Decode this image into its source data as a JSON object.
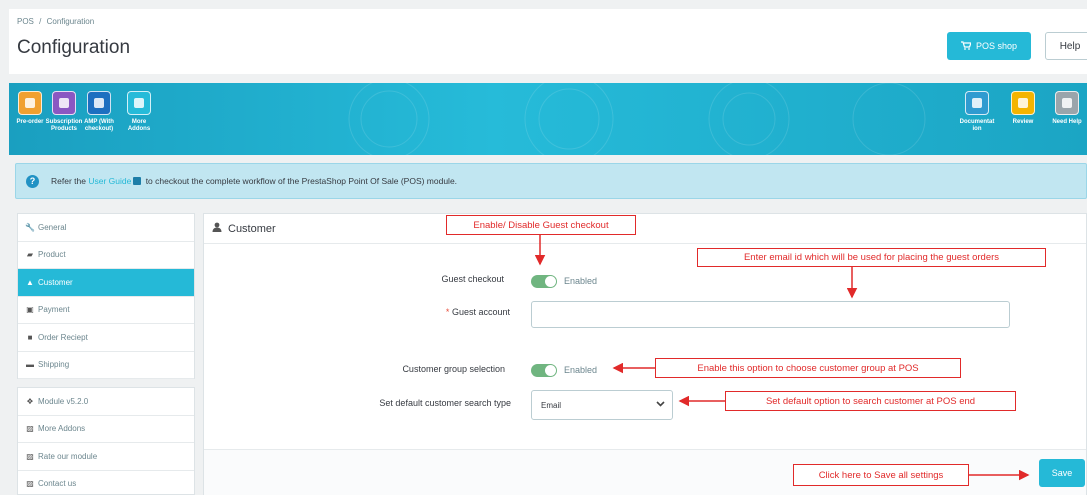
{
  "header": {
    "breadcrumb": [
      "POS",
      "/",
      "Configuration"
    ],
    "title": "Configuration",
    "pos_shop_label": "POS shop",
    "help_label": "Help"
  },
  "addons_left": [
    {
      "label": "Pre-order",
      "icon": "preorder-icon",
      "color": "#f0a030"
    },
    {
      "label": "Subscription\nProducts",
      "icon": "subscription-icon",
      "color": "#8a57c2"
    },
    {
      "label": "AMP (With\ncheckout)",
      "icon": "amp-icon",
      "color": "#1d6fc0"
    },
    {
      "label": "More\nAddons",
      "icon": "puzzle-icon",
      "color": "#26bbd9"
    }
  ],
  "addons_right": [
    {
      "label": "Documentat\nion",
      "icon": "documentation-icon",
      "color": "#2f9bd0"
    },
    {
      "label": "Review",
      "icon": "star-icon",
      "color": "#f4b400"
    },
    {
      "label": "Need Help",
      "icon": "help-circle-icon",
      "color": "#9aa5ab"
    }
  ],
  "info": {
    "prefix": "Refer the ",
    "link": "User Guide",
    "suffix": " to checkout the complete workflow of the PrestaShop Point Of Sale (POS) module."
  },
  "sidebar_top": [
    {
      "label": "General",
      "icon": "wrench-icon",
      "glyph": "🔧"
    },
    {
      "label": "Product",
      "icon": "product-icon",
      "glyph": "▰"
    },
    {
      "label": "Customer",
      "icon": "user-icon",
      "glyph": "▲",
      "active": true
    },
    {
      "label": "Payment",
      "icon": "payment-icon",
      "glyph": "▣"
    },
    {
      "label": "Order Reciept",
      "icon": "file-icon",
      "glyph": "■"
    },
    {
      "label": "Shipping",
      "icon": "truck-icon",
      "glyph": "▬"
    }
  ],
  "sidebar_bottom": [
    {
      "label": "Module v5.2.0",
      "icon": "puzzle-icon",
      "glyph": "❖"
    },
    {
      "label": "More Addons",
      "icon": "external-link-icon",
      "glyph": "▨"
    },
    {
      "label": "Rate our module",
      "icon": "external-link-icon",
      "glyph": "▨"
    },
    {
      "label": "Contact us",
      "icon": "external-link-icon",
      "glyph": "▨"
    }
  ],
  "panel": {
    "title": "Customer",
    "guest_checkout_label": "Guest checkout",
    "guest_checkout_state": "Enabled",
    "guest_account_label": "Guest account",
    "guest_account_required": "*",
    "guest_account_value": "",
    "customer_group_label": "Customer group selection",
    "customer_group_state": "Enabled",
    "search_type_label": "Set default customer search type",
    "search_type_value": "Email",
    "save_label": "Save"
  },
  "annotations": {
    "guest_checkout": "Enable/ Disable Guest checkout",
    "guest_email": "Enter email id which will be used for placing the guest orders",
    "customer_group": "Enable this option to choose customer group at POS",
    "search_type": "Set default option to search customer at POS end",
    "save": "Click here to Save all settings"
  },
  "colors": {
    "accent": "#25b9d7",
    "toggle_on": "#70b580",
    "annotation": "#e12a2a"
  }
}
